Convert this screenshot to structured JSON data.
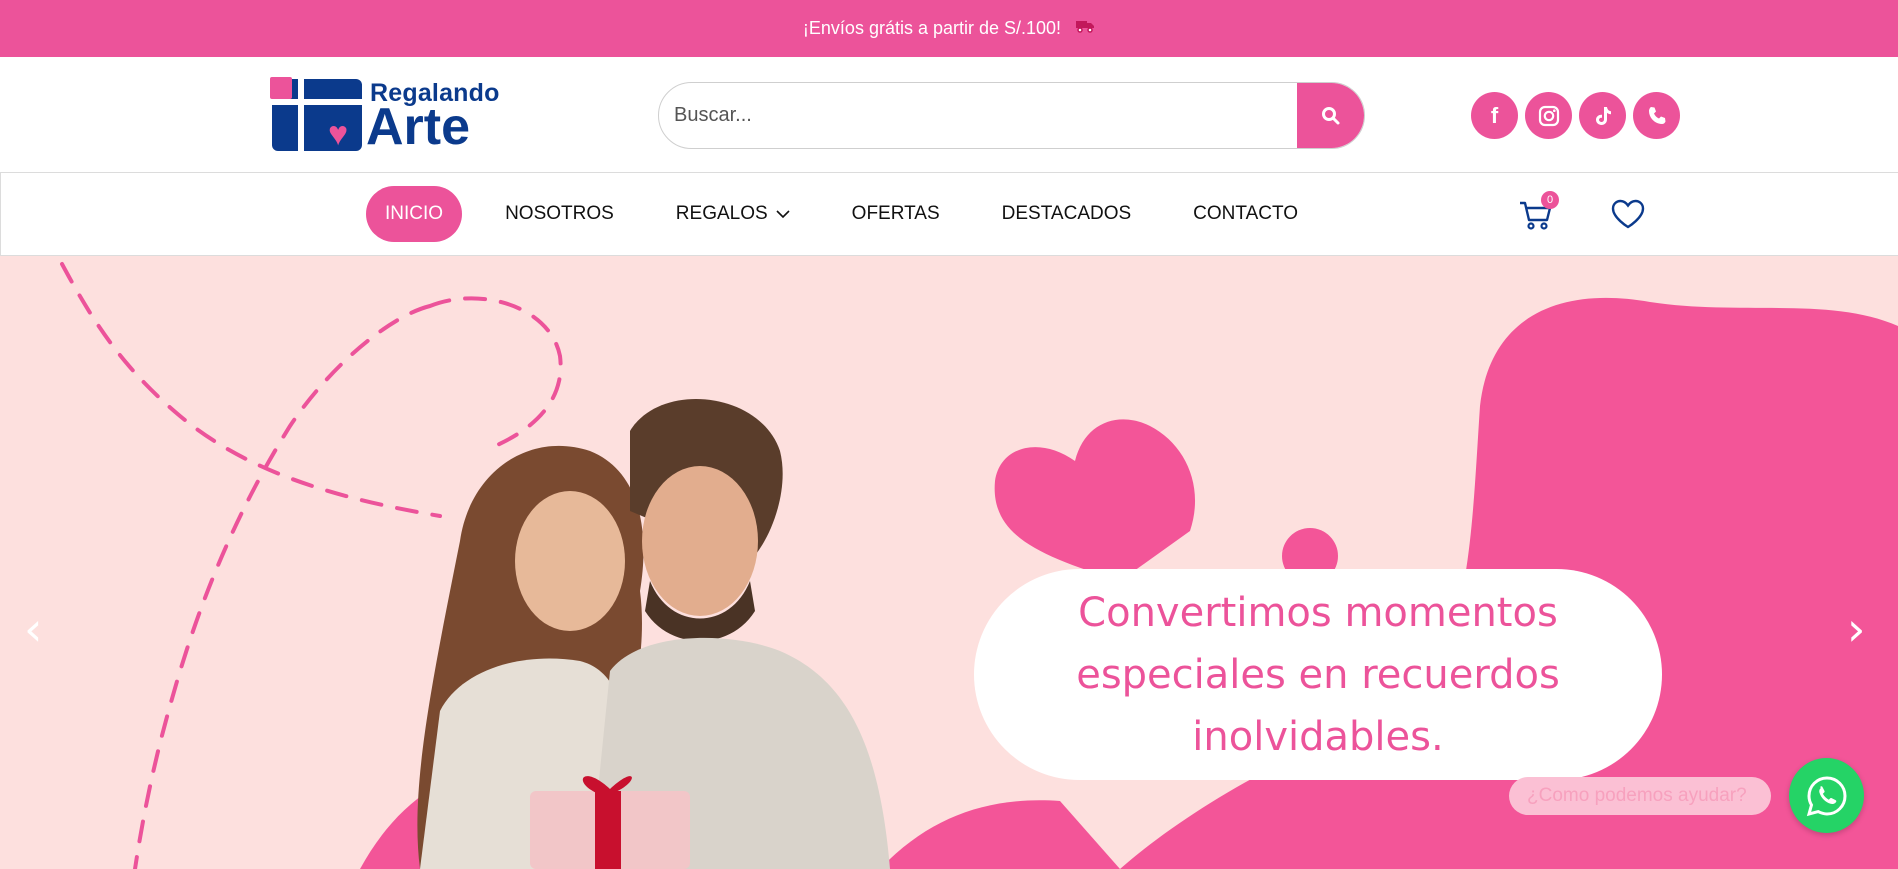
{
  "topbar": {
    "text": "¡Envíos grátis a partir de S/.100!",
    "icon": "truck-icon"
  },
  "logo": {
    "line1": "Regalando",
    "line2": "Arte"
  },
  "search": {
    "placeholder": "Buscar...",
    "value": "",
    "icon": "search-icon"
  },
  "socials": [
    {
      "name": "facebook-icon",
      "glyph": "f"
    },
    {
      "name": "instagram-icon",
      "glyph": ""
    },
    {
      "name": "tiktok-icon",
      "glyph": ""
    },
    {
      "name": "phone-icon",
      "glyph": ""
    }
  ],
  "nav": {
    "items": [
      {
        "label": "INICIO",
        "active": true
      },
      {
        "label": "NOSOTROS",
        "active": false
      },
      {
        "label": "REGALOS",
        "active": false,
        "dropdown": true
      },
      {
        "label": "OFERTAS",
        "active": false
      },
      {
        "label": "DESTACADOS",
        "active": false
      },
      {
        "label": "CONTACTO",
        "active": false
      }
    ],
    "cart_count": "0"
  },
  "hero": {
    "headline": "Convertimos momentos especiales en recuerdos inolvidables.",
    "prev_arrow": "‹",
    "next_arrow": "›"
  },
  "chat": {
    "prompt": "¿Como podemos ayudar?"
  },
  "colors": {
    "accent": "#ec539a",
    "brand_blue": "#0b3a8c",
    "hero_bg": "#fde0de",
    "whatsapp": "#25d366"
  }
}
